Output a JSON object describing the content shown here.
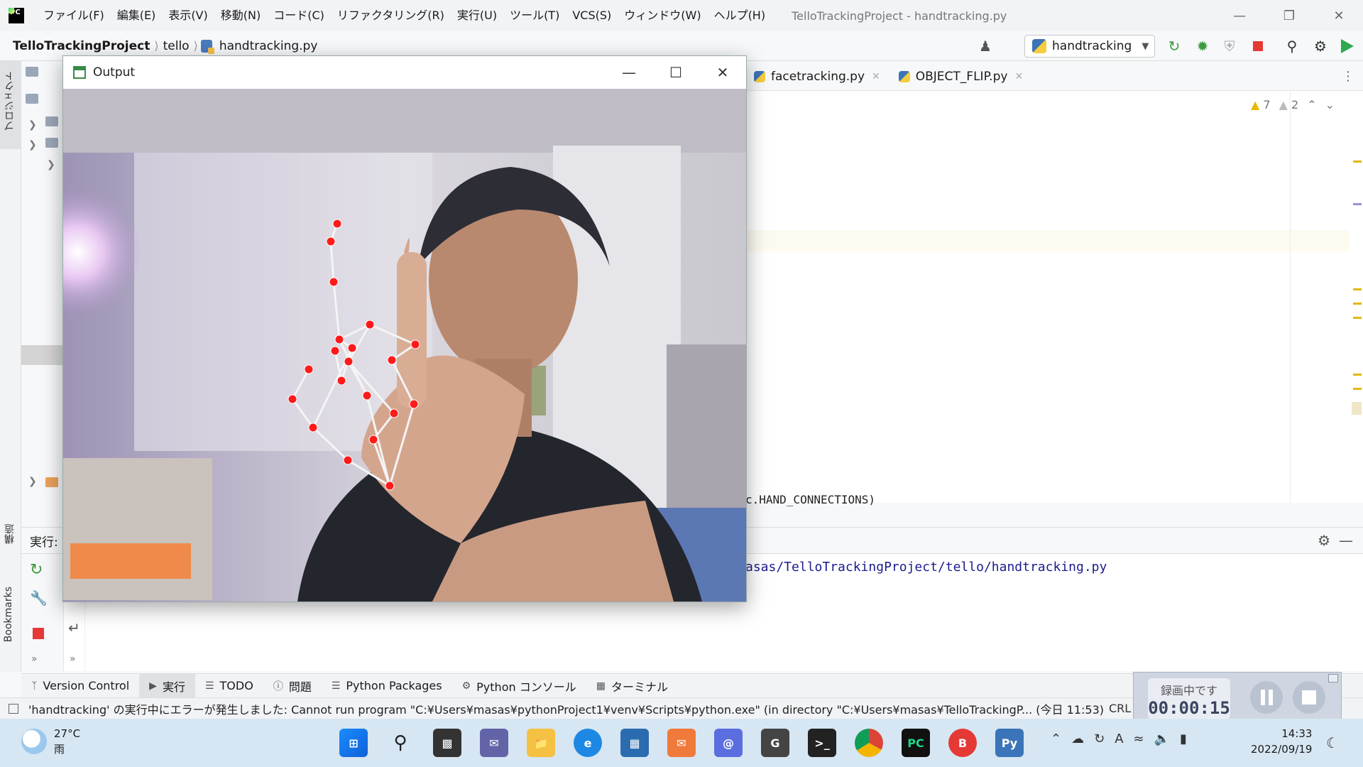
{
  "menubar": {
    "items": [
      "ファイル(F)",
      "編集(E)",
      "表示(V)",
      "移動(N)",
      "コード(C)",
      "リファクタリング(R)",
      "実行(U)",
      "ツール(T)",
      "VCS(S)",
      "ウィンドウ(W)",
      "ヘルプ(H)"
    ],
    "window_title": "TelloTrackingProject - handtracking.py"
  },
  "navbar": {
    "project": "TelloTrackingProject",
    "folder": "tello",
    "file": "handtracking.py",
    "run_config": "handtracking"
  },
  "editor": {
    "tabs": [
      {
        "label": "facetracking.py"
      },
      {
        "label": "OBJECT_FLIP.py"
      }
    ],
    "warnings": "7",
    "weak_warnings": "2",
    "code_fragment": "c.HAND_CONNECTIONS)"
  },
  "left_stripe": {
    "project_tab": "プロジェクト",
    "structure_tab": "構造",
    "bookmarks_tab": "Bookmarks"
  },
  "run_panel": {
    "label": "実行:",
    "output_line": "asas/TelloTrackingProject/tello/handtracking.py"
  },
  "bottom_tabs": [
    {
      "label": "Version Control",
      "icon": "branch-icon"
    },
    {
      "label": "実行",
      "icon": "play-icon"
    },
    {
      "label": "TODO",
      "icon": "list-icon"
    },
    {
      "label": "問題",
      "icon": "problem-icon"
    },
    {
      "label": "Python Packages",
      "icon": "packages-icon"
    },
    {
      "label": "Python コンソール",
      "icon": "python-console-icon"
    },
    {
      "label": "ターミナル",
      "icon": "terminal-icon"
    }
  ],
  "statusbar": {
    "message": "'handtracking' の実行中にエラーが発生しました: Cannot run program \"C:¥Users¥masas¥pythonProject1¥venv¥Scripts¥python.exe\" (in directory \"C:¥Users¥masas¥TelloTrackingP... (今日 11:53)",
    "line_sep": "CRL"
  },
  "recorder": {
    "label": "録画中です",
    "time": "00:00:15"
  },
  "output_window": {
    "title": "Output"
  },
  "taskbar": {
    "temperature": "27°C",
    "weather": "雨",
    "time": "14:33",
    "date": "2022/09/19"
  },
  "colors": {
    "accent_red": "#e53935",
    "landmark_red": "#ff1a1a",
    "connection_white": "#f4f4f4",
    "warning_yellow": "#e6b800"
  }
}
